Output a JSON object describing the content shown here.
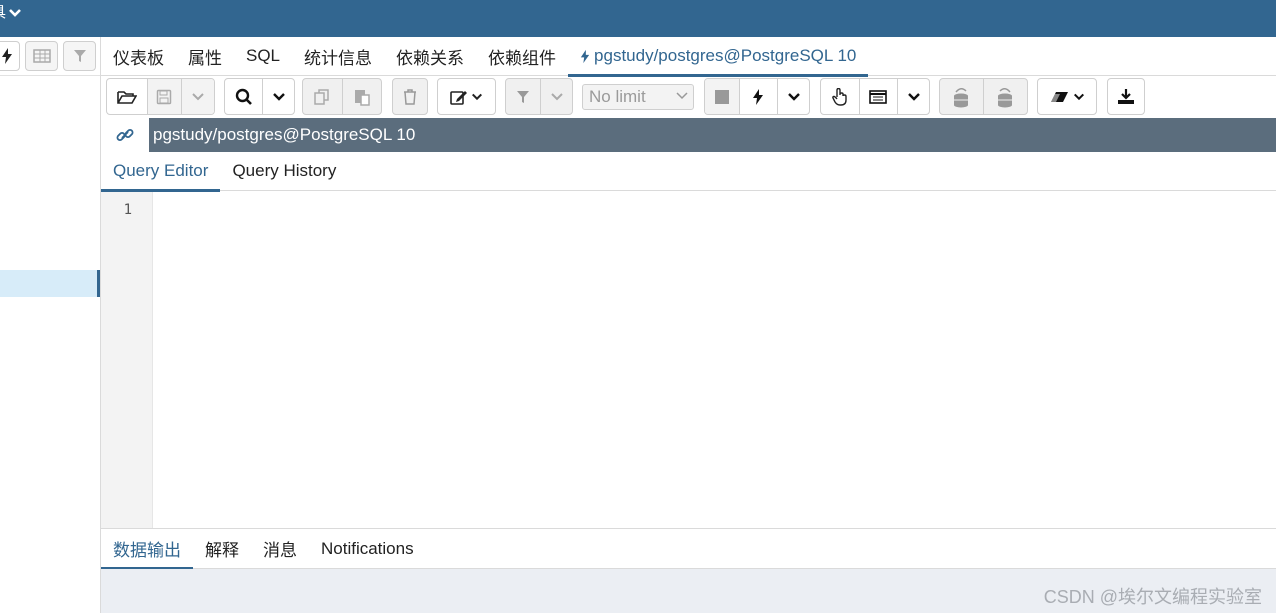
{
  "top_bar": {
    "menu_fragment": "工具"
  },
  "main_tabs": [
    {
      "label": "仪表板",
      "active": false
    },
    {
      "label": "属性",
      "active": false
    },
    {
      "label": "SQL",
      "active": false
    },
    {
      "label": "统计信息",
      "active": false
    },
    {
      "label": "依赖关系",
      "active": false
    },
    {
      "label": "依赖组件",
      "active": false
    },
    {
      "label": "pgstudy/postgres@PostgreSQL 10",
      "active": true,
      "icon": "bolt-icon"
    }
  ],
  "query_toolbar": {
    "limit_select": {
      "value": "No limit"
    }
  },
  "connection": {
    "title": "pgstudy/postgres@PostgreSQL 10",
    "icon": "link-icon"
  },
  "editor_tabs": [
    {
      "label": "Query Editor",
      "active": true
    },
    {
      "label": "Query History",
      "active": false
    }
  ],
  "editor": {
    "line_numbers": [
      "1"
    ],
    "content": ""
  },
  "results_tabs": [
    {
      "label": "数据输出",
      "active": true
    },
    {
      "label": "解释",
      "active": false
    },
    {
      "label": "消息",
      "active": false
    },
    {
      "label": "Notifications",
      "active": false
    }
  ],
  "watermark": "CSDN @埃尔文编程实验室",
  "colors": {
    "accent": "#326690",
    "conn_bar": "#5b6d7d",
    "selected_tree": "#d7ecf9"
  }
}
